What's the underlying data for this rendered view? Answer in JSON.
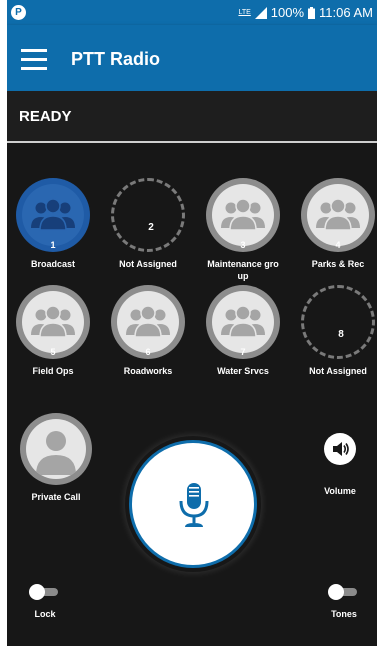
{
  "status_bar": {
    "badge": "P",
    "network": "LTE",
    "battery": "100%",
    "time": "11:06 AM"
  },
  "app_bar": {
    "title": "PTT Radio"
  },
  "status": {
    "text": "READY"
  },
  "channels": [
    {
      "number": "1",
      "label": "Broadcast",
      "assigned": true,
      "active": true
    },
    {
      "number": "2",
      "label": "Not Assigned",
      "assigned": false,
      "active": false
    },
    {
      "number": "3",
      "label": "Maintenance gro up",
      "assigned": true,
      "active": false
    },
    {
      "number": "4",
      "label": "Parks & Rec",
      "assigned": true,
      "active": false
    },
    {
      "number": "5",
      "label": "Field Ops",
      "assigned": true,
      "active": false
    },
    {
      "number": "6",
      "label": "Roadworks",
      "assigned": true,
      "active": false
    },
    {
      "number": "7",
      "label": "Water Srvcs",
      "assigned": true,
      "active": false
    },
    {
      "number": "8",
      "label": "Not Assigned",
      "assigned": false,
      "active": false
    }
  ],
  "private_call": {
    "label": "Private Call"
  },
  "volume": {
    "label": "Volume",
    "icon": "speaker-icon"
  },
  "lock": {
    "label": "Lock",
    "on": false
  },
  "tones": {
    "label": "Tones",
    "on": false
  },
  "colors": {
    "brand": "#0e6dab",
    "background": "#171717",
    "active_channel": "#2a67b1",
    "empty_channel": "#7a7a7a"
  }
}
